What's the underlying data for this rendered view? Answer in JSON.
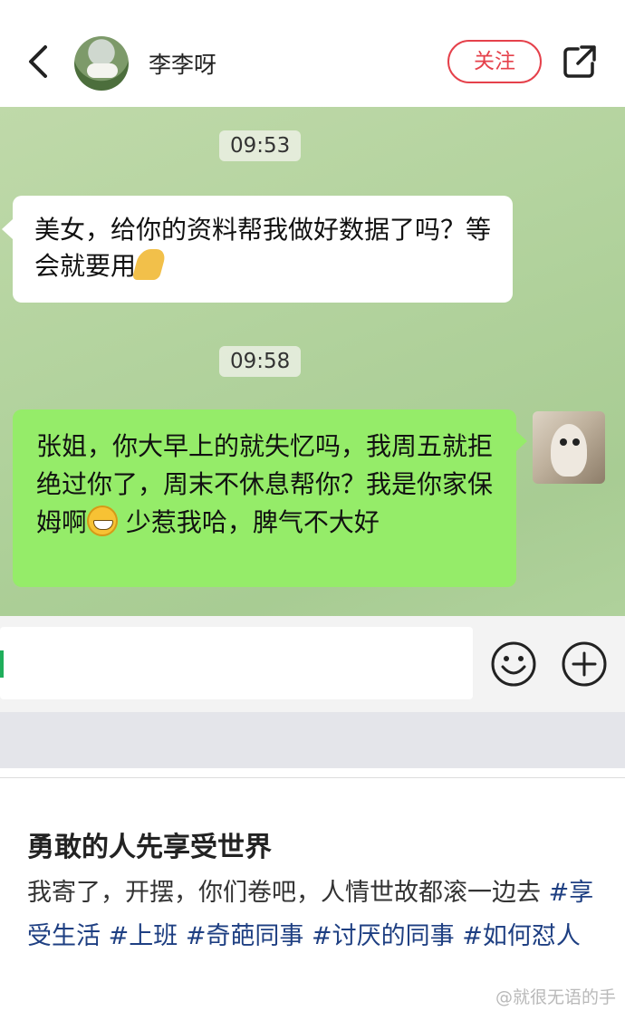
{
  "header": {
    "contact_name": "李李呀",
    "follow_label": "关注"
  },
  "chat": {
    "messages": [
      {
        "time": "09:53",
        "side": "left",
        "text": "美女，给你的资料帮我做好数据了吗？等会就要用",
        "emoji": "folded-hands"
      },
      {
        "time": "09:58",
        "side": "right",
        "text_before_emoji": "张姐，你大早上的就失忆吗，我周五就拒绝过你了，周末不休息帮你？我是你家保姆啊",
        "emoji": "grinning-face",
        "text_after_emoji": "少惹我哈，脾气不大好"
      }
    ]
  },
  "post": {
    "title": "勇敢的人先享受世界",
    "body_text": "我寄了，开摆，你们卷吧，人情世故都滚一边去",
    "hashtags": [
      "#享受生活",
      "#上班",
      "#奇葩同事",
      "#讨厌的同事",
      "#如何怼人"
    ]
  },
  "watermark": "@就很无语的手",
  "colors": {
    "follow_red": "#e5414b",
    "sent_bubble_green": "#95ec69",
    "hashtag_blue": "#1e3f82",
    "cursor_green": "#1fae5b"
  }
}
